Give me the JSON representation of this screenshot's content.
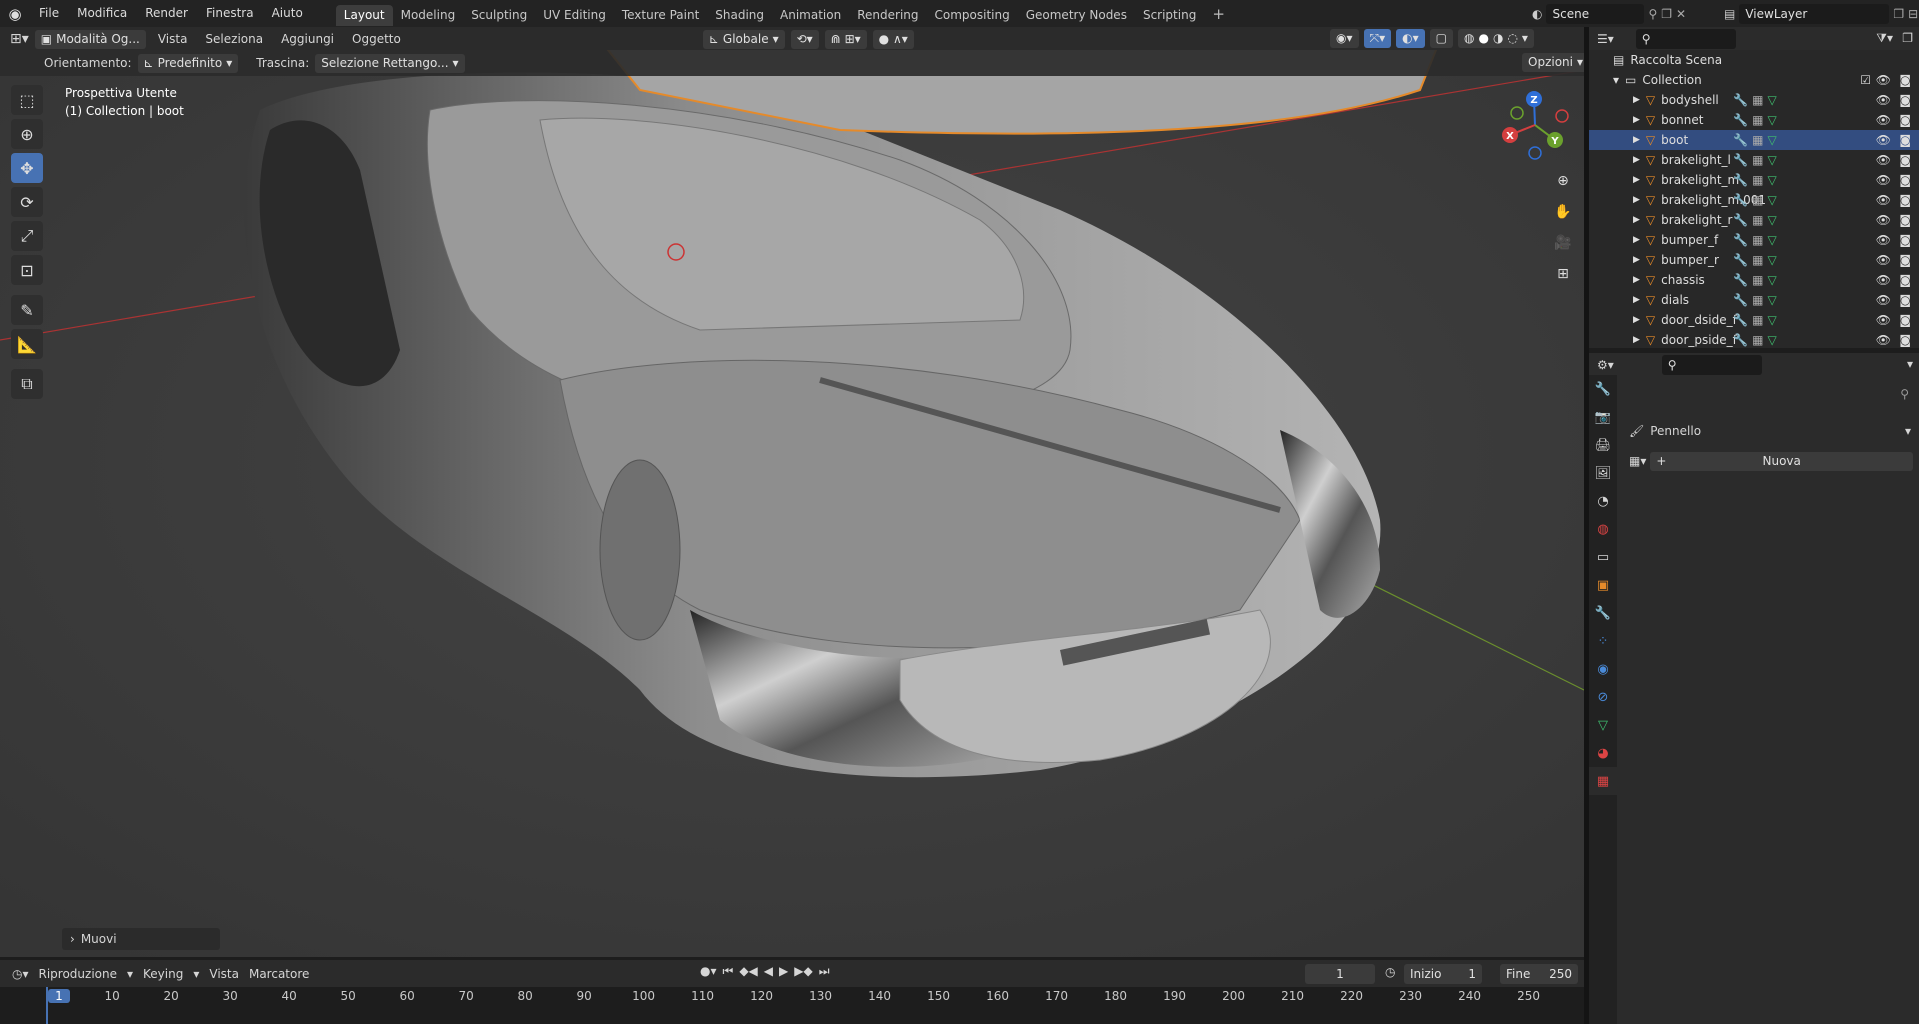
{
  "topbar": {
    "menus": [
      "File",
      "Modifica",
      "Render",
      "Finestra",
      "Aiuto"
    ],
    "workspaces": [
      "Layout",
      "Modeling",
      "Sculpting",
      "UV Editing",
      "Texture Paint",
      "Shading",
      "Animation",
      "Rendering",
      "Compositing",
      "Geometry Nodes",
      "Scripting"
    ],
    "active_workspace": "Layout",
    "scene": "Scene",
    "viewlayer": "ViewLayer"
  },
  "viewport_header": {
    "mode": "Modalità Og...",
    "menus": [
      "Vista",
      "Seleziona",
      "Aggiungi",
      "Oggetto"
    ],
    "transform_orientation": "Globale",
    "orientamento_label": "Orientamento:",
    "orientamento_value": "Predefinito",
    "trascina_label": "Trascina:",
    "trascina_value": "Selezione Rettango...",
    "options": "Opzioni"
  },
  "viewport": {
    "view_name": "Prospettiva Utente",
    "collection_info": "(1) Collection | boot",
    "last_op": "Muovi",
    "gizmo_axes": {
      "x": "X",
      "y": "Y",
      "z": "Z"
    }
  },
  "outliner": {
    "root": "Raccolta Scena",
    "collection": "Collection",
    "items": [
      "bodyshell",
      "bonnet",
      "boot",
      "brakelight_l",
      "brakelight_m",
      "brakelight_m.001",
      "brakelight_r",
      "bumper_f",
      "bumper_r",
      "chassis",
      "dials",
      "door_dside_f",
      "door_pside_f"
    ],
    "selected": "boot"
  },
  "properties": {
    "brush_label": "Pennello",
    "new_button": "Nuova"
  },
  "timeline": {
    "menus": [
      "Riproduzione",
      "Keying",
      "Vista",
      "Marcatore"
    ],
    "current_frame": "1",
    "start_label": "Inizio",
    "start": "1",
    "end_label": "Fine",
    "end": "250",
    "ticks": [
      "1",
      "10",
      "20",
      "30",
      "40",
      "50",
      "60",
      "70",
      "80",
      "90",
      "100",
      "110",
      "120",
      "130",
      "140",
      "150",
      "160",
      "170",
      "180",
      "190",
      "200",
      "210",
      "220",
      "230",
      "240",
      "250"
    ]
  },
  "colors": {
    "accent": "#4772b3",
    "selection": "#334d80",
    "orange": "#e58a2a"
  }
}
